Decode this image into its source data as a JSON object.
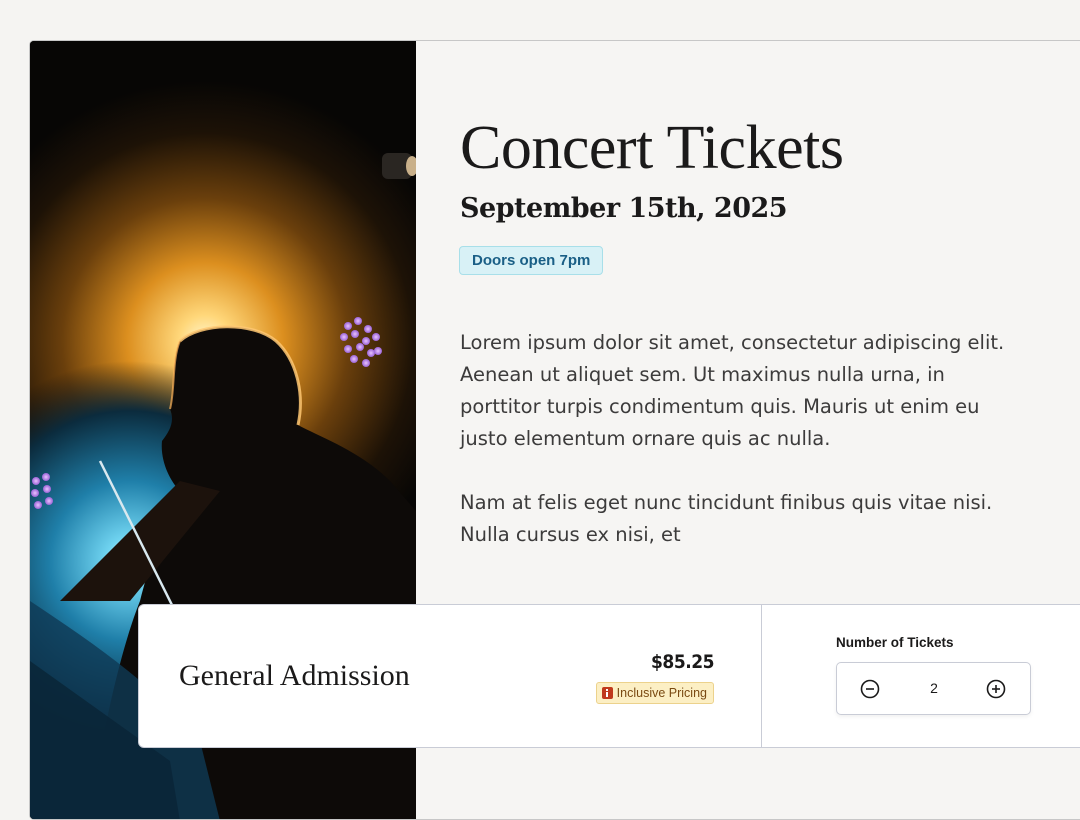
{
  "event": {
    "title": "Concert Tickets",
    "date": "September 15th, 2025",
    "doors_badge": "Doors open 7pm",
    "description": [
      "Lorem ipsum dolor sit amet, consectetur adipiscing elit. Aenean ut aliquet sem. Ut maximus nulla urna, in porttitor turpis condimentum quis. Mauris ut enim eu justo elementum ornare quis ac nulla.",
      "Nam at felis eget nunc tincidunt finibus quis vitae nisi. Nulla cursus ex nisi, et"
    ]
  },
  "ticket": {
    "name": "General Admission",
    "price": "$85.25",
    "pricing_badge": "Inclusive Pricing",
    "quantity_label": "Number of Tickets",
    "quantity": "2"
  },
  "icons": {
    "pricing_badge": "info-icon",
    "decrement": "minus-circle-icon",
    "increment": "plus-circle-icon"
  },
  "colors": {
    "doors_badge_bg": "#d8f1f6",
    "doors_badge_text": "#1a5f86",
    "pricing_badge_bg": "#fcefc4",
    "pricing_badge_text": "#7a4a12",
    "info_icon": "#c0391d"
  }
}
